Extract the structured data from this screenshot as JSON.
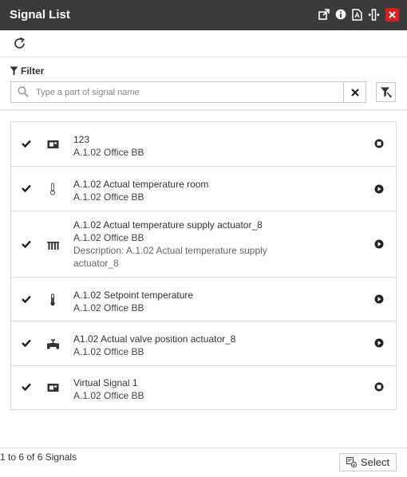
{
  "window": {
    "title": "Signal List",
    "buttons": [
      "popout-icon",
      "info-icon",
      "pdf-icon",
      "resize-icon",
      "close-icon"
    ]
  },
  "filter": {
    "label": "Filter",
    "search_placeholder": "Type a part of signal name",
    "search_value": ""
  },
  "signals": [
    {
      "name": "123",
      "location": "A.1.02 Office BB",
      "description": "",
      "icon": "virtual-signal-icon",
      "checked": true,
      "status": "stop-icon"
    },
    {
      "name": "A.1.02 Actual temperature room",
      "location": "A.1.02 Office BB",
      "description": "",
      "icon": "thermometer-icon",
      "checked": true,
      "status": "play-icon"
    },
    {
      "name": "A.1.02 Actual temperature supply actuator_8",
      "location": "A.1.02 Office BB",
      "description": "Description: A.1.02 Actual temperature supply actuator_8",
      "icon": "radiator-icon",
      "checked": true,
      "status": "play-icon"
    },
    {
      "name": "A.1.02 Setpoint temperature",
      "location": "A.1.02 Office BB",
      "description": "",
      "icon": "thermometer-filled-icon",
      "checked": true,
      "status": "play-icon"
    },
    {
      "name": "A1.02 Actual valve position actuator_8",
      "location": "A.1.02 Office BB",
      "description": "",
      "icon": "valve-icon",
      "checked": true,
      "status": "play-icon"
    },
    {
      "name": "Virtual Signal 1",
      "location": "A.1.02 Office BB",
      "description": "",
      "icon": "virtual-signal-icon",
      "checked": true,
      "status": "stop-icon"
    }
  ],
  "footer": {
    "count_text": "1 to 6 of 6 Signals",
    "select_label": "Select"
  },
  "colors": {
    "titlebar": "#3a3a3a",
    "close": "#d9201f"
  }
}
